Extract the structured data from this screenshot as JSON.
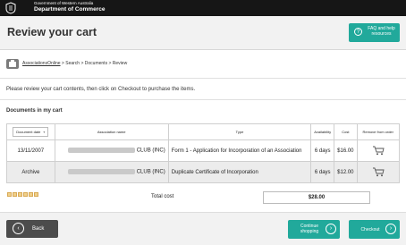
{
  "gov": {
    "line1": "Government of Western Australia",
    "line2": "Department of Commerce"
  },
  "header": {
    "title": "Review your cart",
    "faq_label": "FAQ and help resources"
  },
  "breadcrumb": {
    "home": "AssociationsOnline",
    "items": [
      "Search",
      "Documents",
      "Review"
    ],
    "separator": ">"
  },
  "intro_text": "Please review your cart contents, then click on Checkout to purchase the items.",
  "section_title": "Documents in my cart",
  "table": {
    "headers": {
      "date": "Document date",
      "association": "Association name",
      "type": "Type",
      "availability": "Availability",
      "cost": "Cost",
      "remove": "Remove from order"
    },
    "rows": [
      {
        "date": "13/11/2007",
        "association": "CLUB (INC)",
        "type": "Form 1 - Application for Incorporation of an Association",
        "availability": "6 days",
        "cost": "$16.00"
      },
      {
        "date": "Archive",
        "association": "CLUB (INC)",
        "type": "Duplicate Certificate of Incorporation",
        "availability": "6 days",
        "cost": "$12.00"
      }
    ]
  },
  "total": {
    "label": "Total cost",
    "value": "$28.00"
  },
  "footer": {
    "back": "Back",
    "continue": "Continue shopping",
    "checkout": "Checkout"
  },
  "colors": {
    "accent": "#21a99b",
    "topbar": "#161616",
    "back_button": "#4c4c4c"
  }
}
